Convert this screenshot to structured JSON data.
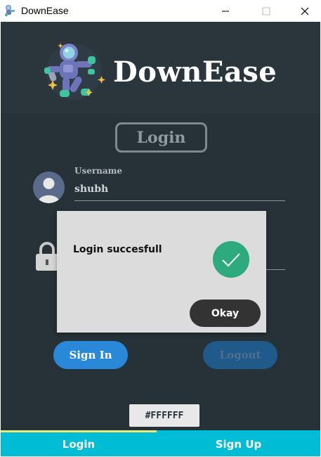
{
  "window": {
    "title": "DownEase",
    "minimize_icon": "minimize-icon",
    "maximize_icon": "maximize-icon",
    "close_icon": "close-icon"
  },
  "header": {
    "brand": "DownEase",
    "logo_icon": "astronaut-logo"
  },
  "form": {
    "heading": "Login",
    "username_label": "Username",
    "username_value": "shubh",
    "username_icon": "user-avatar-icon",
    "password_icon": "lock-icon"
  },
  "buttons": {
    "signin": "Sign In",
    "logout": "Logout"
  },
  "color_chip": "#FFFFFF",
  "tabs": [
    {
      "label": "Login",
      "active": true
    },
    {
      "label": "Sign Up",
      "active": false
    }
  ],
  "dialog": {
    "message": "Login succesfull",
    "okay": "Okay",
    "icon": "check-circle-icon"
  },
  "colors": {
    "background": "#263238",
    "tab_bar": "#00bcd4",
    "signin": "#2a88d9",
    "success": "#2eaa7f"
  }
}
